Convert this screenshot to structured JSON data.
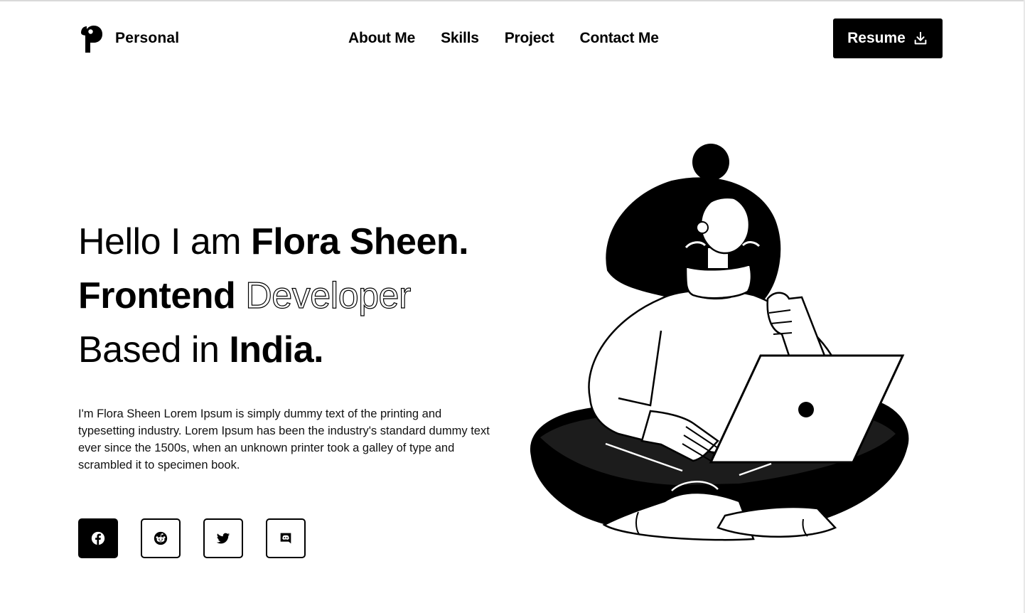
{
  "brand": {
    "name": "Personal"
  },
  "nav": {
    "items": [
      "About Me",
      "Skills",
      "Project",
      "Contact Me"
    ]
  },
  "header": {
    "resume_label": "Resume"
  },
  "hero": {
    "line1_light": "Hello I am ",
    "line1_bold": "Flora Sheen.",
    "line2_bold": "Frontend ",
    "line2_outline": "Developer",
    "line3_light": "Based in ",
    "line3_bold": "India.",
    "intro": "I'm Flora Sheen Lorem Ipsum is simply dummy text of the printing and typesetting industry. Lorem Ipsum has been the industry's standard dummy text ever since the 1500s, when an unknown printer took a galley of type and scrambled it to specimen book."
  },
  "socials": [
    {
      "icon": "facebook-icon",
      "active": true
    },
    {
      "icon": "reddit-icon",
      "active": false
    },
    {
      "icon": "twitter-icon",
      "active": false
    },
    {
      "icon": "discord-icon",
      "active": false
    }
  ],
  "colors": {
    "primary": "#000000",
    "background": "#ffffff"
  }
}
